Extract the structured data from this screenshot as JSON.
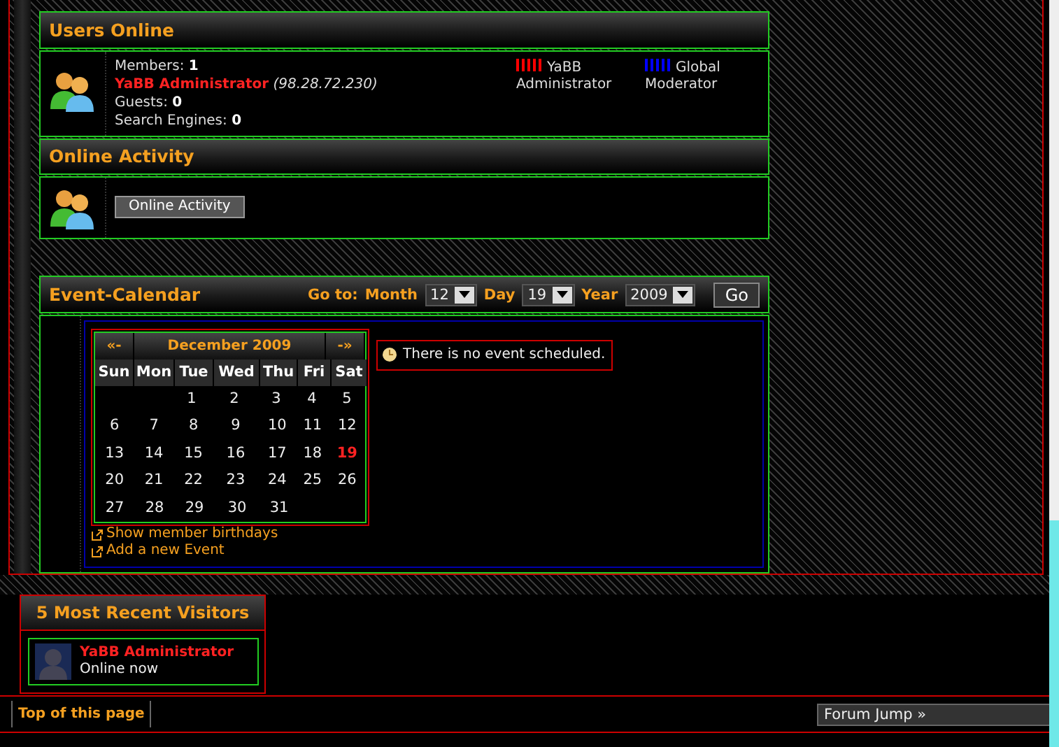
{
  "users_online": {
    "title": "Users Online",
    "members": "Members: **1**",
    "admin_name": "YaBB Administrator",
    "admin_ip": "(98.28.72.230)",
    "guests": "Guests: **0**",
    "search_engines": "Search Engines: **0**",
    "legend": [
      {
        "label": "YaBB Administrator",
        "color": "#ff0000"
      },
      {
        "label": "Global Moderator",
        "color": "#0000ff"
      }
    ]
  },
  "online_activity": {
    "title": "Online Activity",
    "button": "Online Activity"
  },
  "event_calendar": {
    "title": "Event-Calendar",
    "goto_label": "Go to:",
    "selects": [
      {
        "label": "Month",
        "value": "12"
      },
      {
        "label": "Day",
        "value": "19"
      },
      {
        "label": "Year",
        "value": "2009"
      }
    ],
    "go_button": "Go",
    "calendar": {
      "prev": "«-",
      "month_title": "December 2009",
      "next": "-»",
      "weekdays": [
        "Sun",
        "Mon",
        "Tue",
        "Wed",
        "Thu",
        "Fri",
        "Sat"
      ],
      "weeks": [
        [
          {
            "day": "1",
            "today": false
          },
          {
            "day": "2",
            "today": false
          },
          {
            "day": "3",
            "today": false
          },
          {
            "day": "4",
            "today": false
          },
          {
            "day": "5",
            "today": false
          }
        ],
        [
          {
            "day": "6",
            "today": false
          },
          {
            "day": "7",
            "today": false
          },
          {
            "day": "8",
            "today": false
          },
          {
            "day": "9",
            "today": false
          },
          {
            "day": "10",
            "today": false
          },
          {
            "day": "11",
            "today": false
          },
          {
            "day": "12",
            "today": false
          }
        ],
        [
          {
            "day": "13",
            "today": false
          },
          {
            "day": "14",
            "today": false
          },
          {
            "day": "15",
            "today": false
          },
          {
            "day": "16",
            "today": false
          },
          {
            "day": "17",
            "today": false
          },
          {
            "day": "18",
            "today": false
          },
          {
            "day": "19",
            "today": true
          }
        ],
        [
          {
            "day": "20",
            "today": false
          },
          {
            "day": "21",
            "today": false
          },
          {
            "day": "22",
            "today": false
          },
          {
            "day": "23",
            "today": false
          },
          {
            "day": "24",
            "today": false
          },
          {
            "day": "25",
            "today": false
          },
          {
            "day": "26",
            "today": false
          }
        ],
        [
          {
            "day": "27",
            "today": false
          },
          {
            "day": "28",
            "today": false
          },
          {
            "day": "29",
            "today": false
          },
          {
            "day": "30",
            "today": false
          },
          {
            "day": "31",
            "today": false
          }
        ]
      ]
    },
    "message": "There is no event scheduled.",
    "links": [
      "Show member birthdays",
      "Add a new Event"
    ]
  },
  "recent_visitors": {
    "title": "5 Most Recent Visitors",
    "visitors": [
      {
        "name": "YaBB Administrator",
        "status": "Online now"
      }
    ]
  },
  "footer": {
    "top_link": "Top of this page",
    "forum_jump": "Forum Jump »"
  }
}
